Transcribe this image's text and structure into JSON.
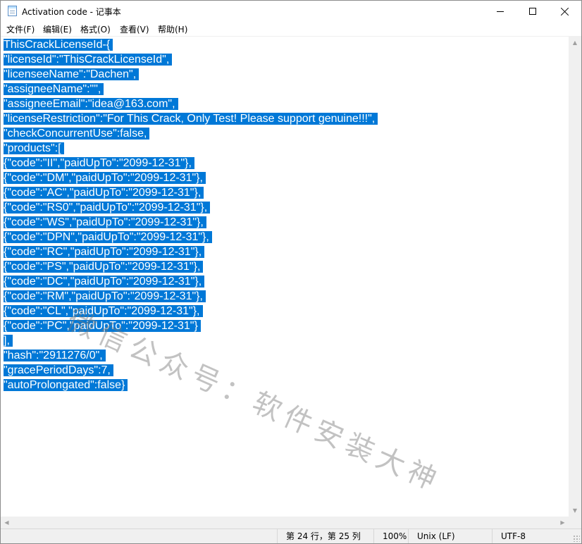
{
  "window": {
    "title": "Activation code - 记事本"
  },
  "menu": [
    "文件(F)",
    "编辑(E)",
    "格式(O)",
    "查看(V)",
    "帮助(H)"
  ],
  "editor": {
    "lines": [
      "ThisCrackLicenseId-{",
      "\"licenseId\":\"ThisCrackLicenseId\",",
      "\"licenseeName\":\"Dachen\",",
      "\"assigneeName\":\"\",",
      "\"assigneeEmail\":\"idea@163.com\",",
      "\"licenseRestriction\":\"For This Crack, Only Test! Please support genuine!!!\",",
      "\"checkConcurrentUse\":false,",
      "\"products\":[",
      "{\"code\":\"II\",\"paidUpTo\":\"2099-12-31\"},",
      "{\"code\":\"DM\",\"paidUpTo\":\"2099-12-31\"},",
      "{\"code\":\"AC\",\"paidUpTo\":\"2099-12-31\"},",
      "{\"code\":\"RS0\",\"paidUpTo\":\"2099-12-31\"},",
      "{\"code\":\"WS\",\"paidUpTo\":\"2099-12-31\"},",
      "{\"code\":\"DPN\",\"paidUpTo\":\"2099-12-31\"},",
      "{\"code\":\"RC\",\"paidUpTo\":\"2099-12-31\"},",
      "{\"code\":\"PS\",\"paidUpTo\":\"2099-12-31\"},",
      "{\"code\":\"DC\",\"paidUpTo\":\"2099-12-31\"},",
      "{\"code\":\"RM\",\"paidUpTo\":\"2099-12-31\"},",
      "{\"code\":\"CL\",\"paidUpTo\":\"2099-12-31\"},",
      "{\"code\":\"PC\",\"paidUpTo\":\"2099-12-31\"}",
      "],",
      "\"hash\":\"2911276/0\",",
      "\"gracePeriodDays\":7,",
      "\"autoProlongated\":false}"
    ],
    "selection_color": "#0078d7",
    "watermark": "微信公众号：软件安装大神"
  },
  "status": {
    "position": "第 24 行，第 25 列",
    "zoom": "100%",
    "line_ending": "Unix (LF)",
    "encoding": "UTF-8"
  }
}
